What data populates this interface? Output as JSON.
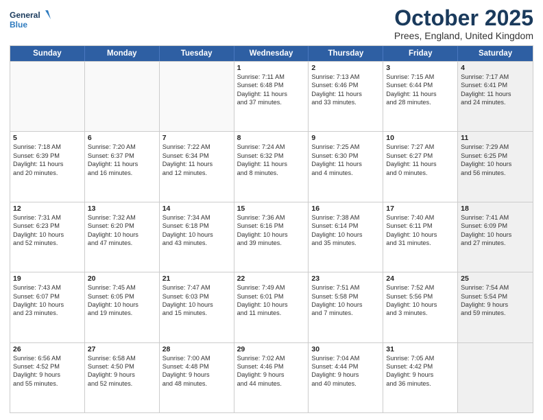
{
  "logo": {
    "line1": "General",
    "line2": "Blue"
  },
  "title": {
    "month": "October 2025",
    "location": "Prees, England, United Kingdom"
  },
  "header_days": [
    "Sunday",
    "Monday",
    "Tuesday",
    "Wednesday",
    "Thursday",
    "Friday",
    "Saturday"
  ],
  "weeks": [
    [
      {
        "day": "",
        "lines": [],
        "empty": true
      },
      {
        "day": "",
        "lines": [],
        "empty": true
      },
      {
        "day": "",
        "lines": [],
        "empty": true
      },
      {
        "day": "1",
        "lines": [
          "Sunrise: 7:11 AM",
          "Sunset: 6:48 PM",
          "Daylight: 11 hours",
          "and 37 minutes."
        ]
      },
      {
        "day": "2",
        "lines": [
          "Sunrise: 7:13 AM",
          "Sunset: 6:46 PM",
          "Daylight: 11 hours",
          "and 33 minutes."
        ]
      },
      {
        "day": "3",
        "lines": [
          "Sunrise: 7:15 AM",
          "Sunset: 6:44 PM",
          "Daylight: 11 hours",
          "and 28 minutes."
        ]
      },
      {
        "day": "4",
        "lines": [
          "Sunrise: 7:17 AM",
          "Sunset: 6:41 PM",
          "Daylight: 11 hours",
          "and 24 minutes."
        ],
        "shaded": true
      }
    ],
    [
      {
        "day": "5",
        "lines": [
          "Sunrise: 7:18 AM",
          "Sunset: 6:39 PM",
          "Daylight: 11 hours",
          "and 20 minutes."
        ]
      },
      {
        "day": "6",
        "lines": [
          "Sunrise: 7:20 AM",
          "Sunset: 6:37 PM",
          "Daylight: 11 hours",
          "and 16 minutes."
        ]
      },
      {
        "day": "7",
        "lines": [
          "Sunrise: 7:22 AM",
          "Sunset: 6:34 PM",
          "Daylight: 11 hours",
          "and 12 minutes."
        ]
      },
      {
        "day": "8",
        "lines": [
          "Sunrise: 7:24 AM",
          "Sunset: 6:32 PM",
          "Daylight: 11 hours",
          "and 8 minutes."
        ]
      },
      {
        "day": "9",
        "lines": [
          "Sunrise: 7:25 AM",
          "Sunset: 6:30 PM",
          "Daylight: 11 hours",
          "and 4 minutes."
        ]
      },
      {
        "day": "10",
        "lines": [
          "Sunrise: 7:27 AM",
          "Sunset: 6:27 PM",
          "Daylight: 11 hours",
          "and 0 minutes."
        ]
      },
      {
        "day": "11",
        "lines": [
          "Sunrise: 7:29 AM",
          "Sunset: 6:25 PM",
          "Daylight: 10 hours",
          "and 56 minutes."
        ],
        "shaded": true
      }
    ],
    [
      {
        "day": "12",
        "lines": [
          "Sunrise: 7:31 AM",
          "Sunset: 6:23 PM",
          "Daylight: 10 hours",
          "and 52 minutes."
        ]
      },
      {
        "day": "13",
        "lines": [
          "Sunrise: 7:32 AM",
          "Sunset: 6:20 PM",
          "Daylight: 10 hours",
          "and 47 minutes."
        ]
      },
      {
        "day": "14",
        "lines": [
          "Sunrise: 7:34 AM",
          "Sunset: 6:18 PM",
          "Daylight: 10 hours",
          "and 43 minutes."
        ]
      },
      {
        "day": "15",
        "lines": [
          "Sunrise: 7:36 AM",
          "Sunset: 6:16 PM",
          "Daylight: 10 hours",
          "and 39 minutes."
        ]
      },
      {
        "day": "16",
        "lines": [
          "Sunrise: 7:38 AM",
          "Sunset: 6:14 PM",
          "Daylight: 10 hours",
          "and 35 minutes."
        ]
      },
      {
        "day": "17",
        "lines": [
          "Sunrise: 7:40 AM",
          "Sunset: 6:11 PM",
          "Daylight: 10 hours",
          "and 31 minutes."
        ]
      },
      {
        "day": "18",
        "lines": [
          "Sunrise: 7:41 AM",
          "Sunset: 6:09 PM",
          "Daylight: 10 hours",
          "and 27 minutes."
        ],
        "shaded": true
      }
    ],
    [
      {
        "day": "19",
        "lines": [
          "Sunrise: 7:43 AM",
          "Sunset: 6:07 PM",
          "Daylight: 10 hours",
          "and 23 minutes."
        ]
      },
      {
        "day": "20",
        "lines": [
          "Sunrise: 7:45 AM",
          "Sunset: 6:05 PM",
          "Daylight: 10 hours",
          "and 19 minutes."
        ]
      },
      {
        "day": "21",
        "lines": [
          "Sunrise: 7:47 AM",
          "Sunset: 6:03 PM",
          "Daylight: 10 hours",
          "and 15 minutes."
        ]
      },
      {
        "day": "22",
        "lines": [
          "Sunrise: 7:49 AM",
          "Sunset: 6:01 PM",
          "Daylight: 10 hours",
          "and 11 minutes."
        ]
      },
      {
        "day": "23",
        "lines": [
          "Sunrise: 7:51 AM",
          "Sunset: 5:58 PM",
          "Daylight: 10 hours",
          "and 7 minutes."
        ]
      },
      {
        "day": "24",
        "lines": [
          "Sunrise: 7:52 AM",
          "Sunset: 5:56 PM",
          "Daylight: 10 hours",
          "and 3 minutes."
        ]
      },
      {
        "day": "25",
        "lines": [
          "Sunrise: 7:54 AM",
          "Sunset: 5:54 PM",
          "Daylight: 9 hours",
          "and 59 minutes."
        ],
        "shaded": true
      }
    ],
    [
      {
        "day": "26",
        "lines": [
          "Sunrise: 6:56 AM",
          "Sunset: 4:52 PM",
          "Daylight: 9 hours",
          "and 55 minutes."
        ]
      },
      {
        "day": "27",
        "lines": [
          "Sunrise: 6:58 AM",
          "Sunset: 4:50 PM",
          "Daylight: 9 hours",
          "and 52 minutes."
        ]
      },
      {
        "day": "28",
        "lines": [
          "Sunrise: 7:00 AM",
          "Sunset: 4:48 PM",
          "Daylight: 9 hours",
          "and 48 minutes."
        ]
      },
      {
        "day": "29",
        "lines": [
          "Sunrise: 7:02 AM",
          "Sunset: 4:46 PM",
          "Daylight: 9 hours",
          "and 44 minutes."
        ]
      },
      {
        "day": "30",
        "lines": [
          "Sunrise: 7:04 AM",
          "Sunset: 4:44 PM",
          "Daylight: 9 hours",
          "and 40 minutes."
        ]
      },
      {
        "day": "31",
        "lines": [
          "Sunrise: 7:05 AM",
          "Sunset: 4:42 PM",
          "Daylight: 9 hours",
          "and 36 minutes."
        ]
      },
      {
        "day": "",
        "lines": [],
        "empty": true,
        "shaded": true
      }
    ]
  ]
}
